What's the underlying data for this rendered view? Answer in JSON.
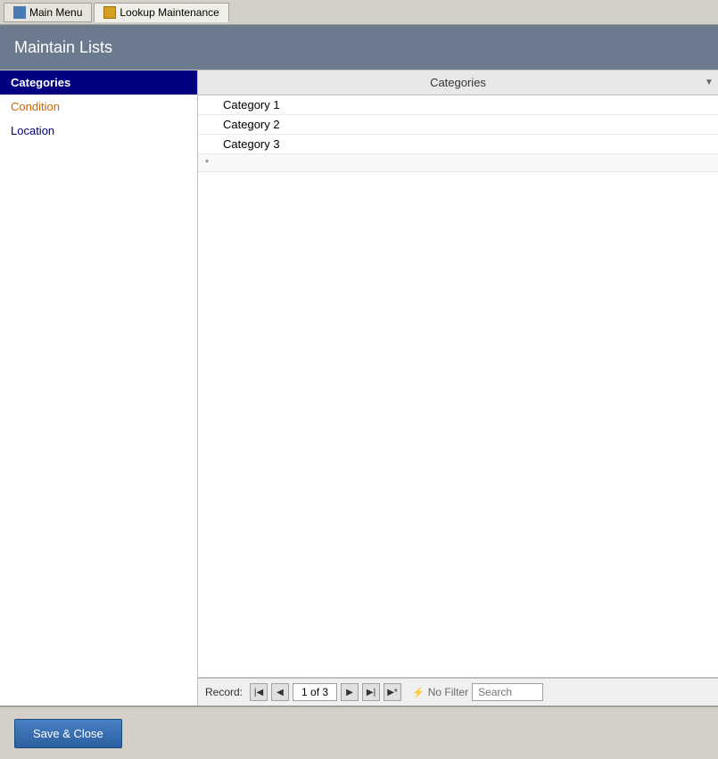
{
  "tabs": [
    {
      "id": "main-menu",
      "label": "Main Menu",
      "icon": "grid-icon",
      "active": false
    },
    {
      "id": "lookup-maintenance",
      "label": "Lookup Maintenance",
      "icon": "table-icon",
      "active": true
    }
  ],
  "header": {
    "title": "Maintain Lists"
  },
  "sidebar": {
    "items": [
      {
        "id": "categories",
        "label": "Categories",
        "selected": true
      },
      {
        "id": "condition",
        "label": "Condition",
        "selected": false
      },
      {
        "id": "location",
        "label": "Location",
        "selected": false
      }
    ]
  },
  "grid": {
    "column": {
      "label": "Categories",
      "dropdown_icon": "▼"
    },
    "rows": [
      {
        "indicator": "",
        "value": "Category 1"
      },
      {
        "indicator": "",
        "value": "Category 2"
      },
      {
        "indicator": "",
        "value": "Category 3"
      }
    ],
    "new_row_indicator": "*"
  },
  "navigation": {
    "record_label": "Record:",
    "first_icon": "◀◀",
    "prev_icon": "◀",
    "next_icon": "▶",
    "last_icon": "▶▶",
    "last_new_icon": "▶*",
    "position": "1 of 3",
    "filter_icon": "⚡",
    "filter_label": "No Filter",
    "search_placeholder": "Search"
  },
  "footer": {
    "save_close_label": "Save & Close"
  }
}
